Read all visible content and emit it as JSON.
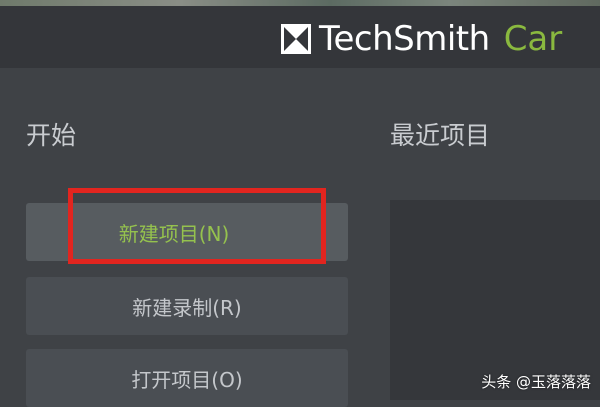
{
  "header": {
    "brand_name": "TechSmith",
    "brand_product": "Car",
    "logo_icon": "techsmith-logo-icon"
  },
  "start": {
    "title": "开始",
    "actions": [
      {
        "label": "新建项目(N)",
        "highlighted": true
      },
      {
        "label": "新建录制(R)",
        "highlighted": false
      },
      {
        "label": "打开项目(O)",
        "highlighted": false
      }
    ]
  },
  "recent": {
    "title": "最近项目"
  },
  "watermark": {
    "text": "头条 @玉落落落"
  },
  "colors": {
    "accent_green": "#95c24e",
    "highlight_red": "#e2251f",
    "background": "#3f4246"
  }
}
